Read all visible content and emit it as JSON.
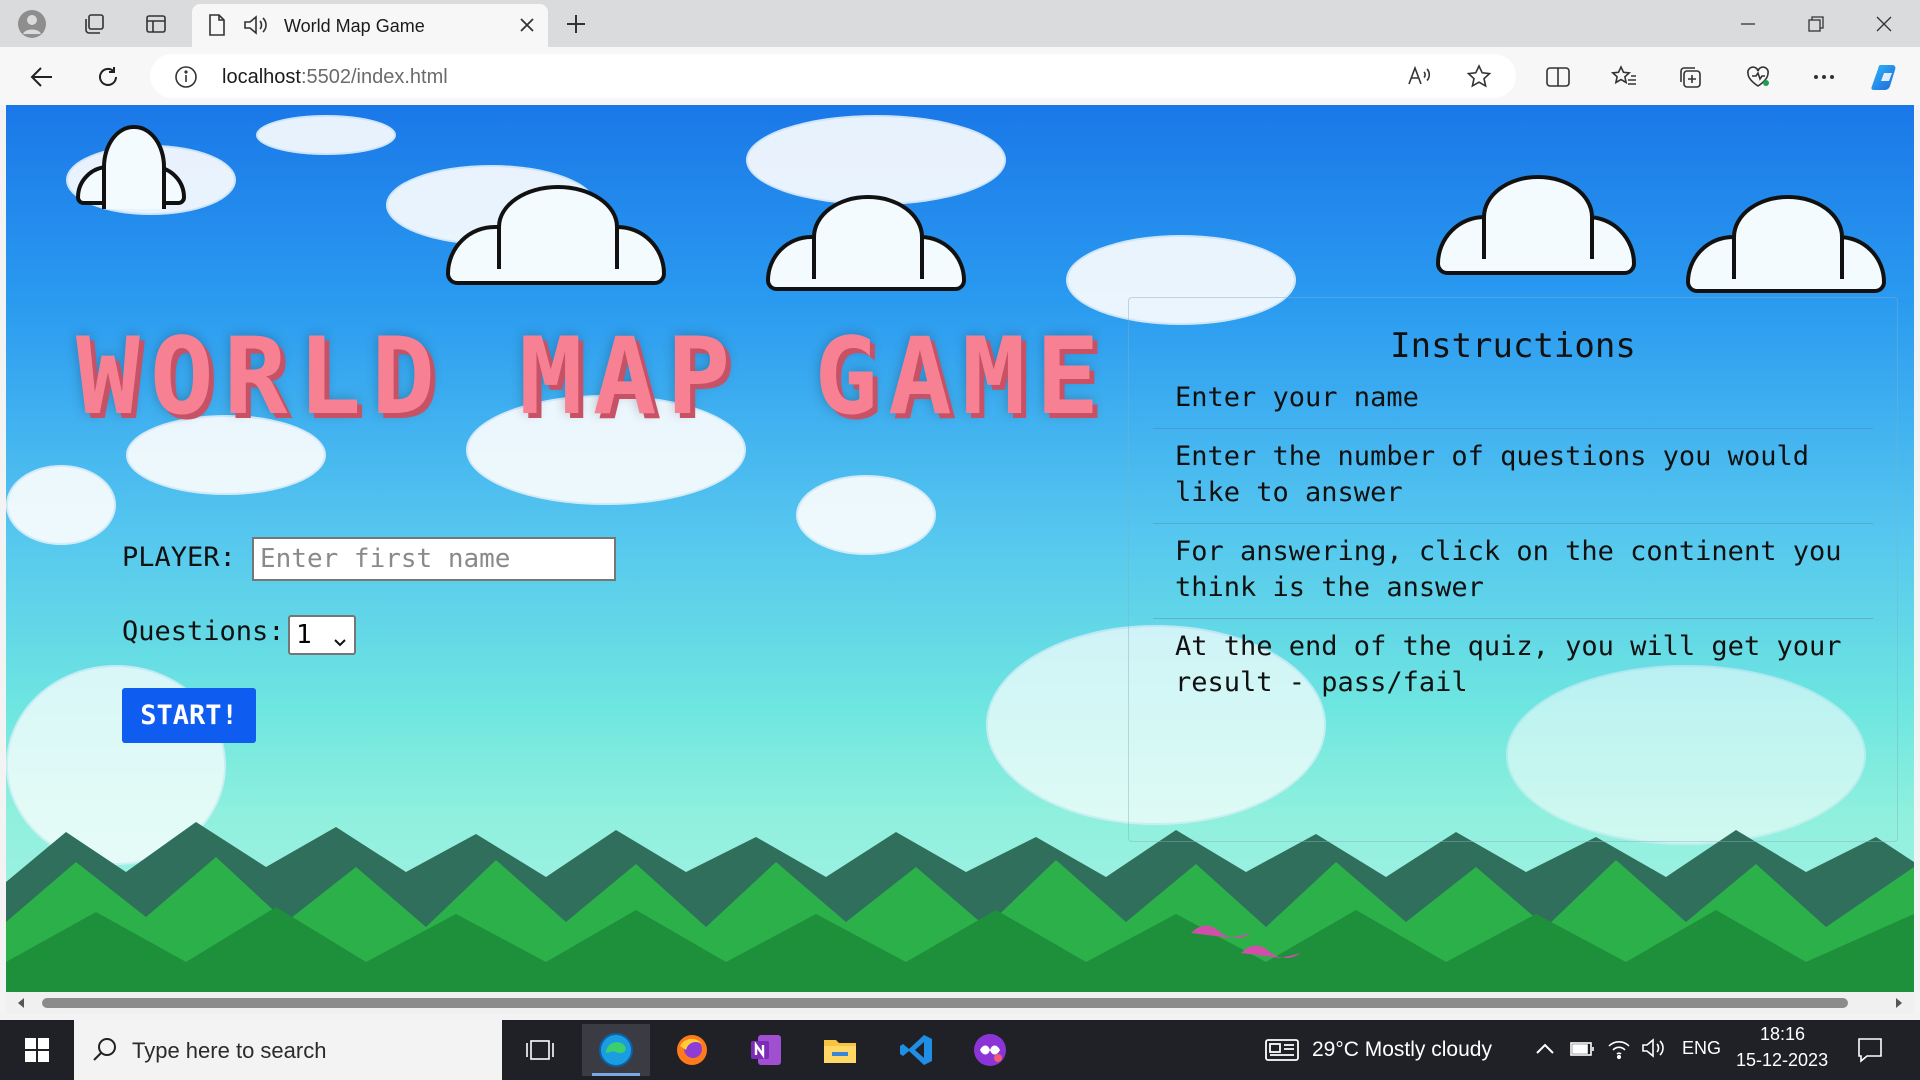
{
  "browser": {
    "tab_title": "World Map Game",
    "url_host": "localhost",
    "url_path": ":5502/index.html"
  },
  "page": {
    "title": "WORLD MAP GAME",
    "player_label": "PLAYER:",
    "player_placeholder": "Enter first name",
    "player_value": "",
    "questions_label": "Questions:",
    "questions_selected": "1",
    "start_label": "START!",
    "instructions_heading": "Instructions",
    "instructions": [
      "Enter your name",
      "Enter the number of questions you would like to answer",
      "For answering, click on the continent you think is the answer",
      "At the end of the quiz, you will get your result - pass/fail"
    ]
  },
  "taskbar": {
    "search_placeholder": "Type here to search",
    "weather": "29°C  Mostly cloudy",
    "language": "ENG",
    "time": "18:16",
    "date": "15-12-2023",
    "apps": [
      "task-view-icon",
      "edge-icon",
      "firefox-icon",
      "onenote-icon",
      "file-explorer-icon",
      "vscode-icon",
      "game-app-icon"
    ]
  },
  "colors": {
    "title": "#f78193",
    "start_button": "#0f5cf0",
    "taskbar": "#202027"
  }
}
